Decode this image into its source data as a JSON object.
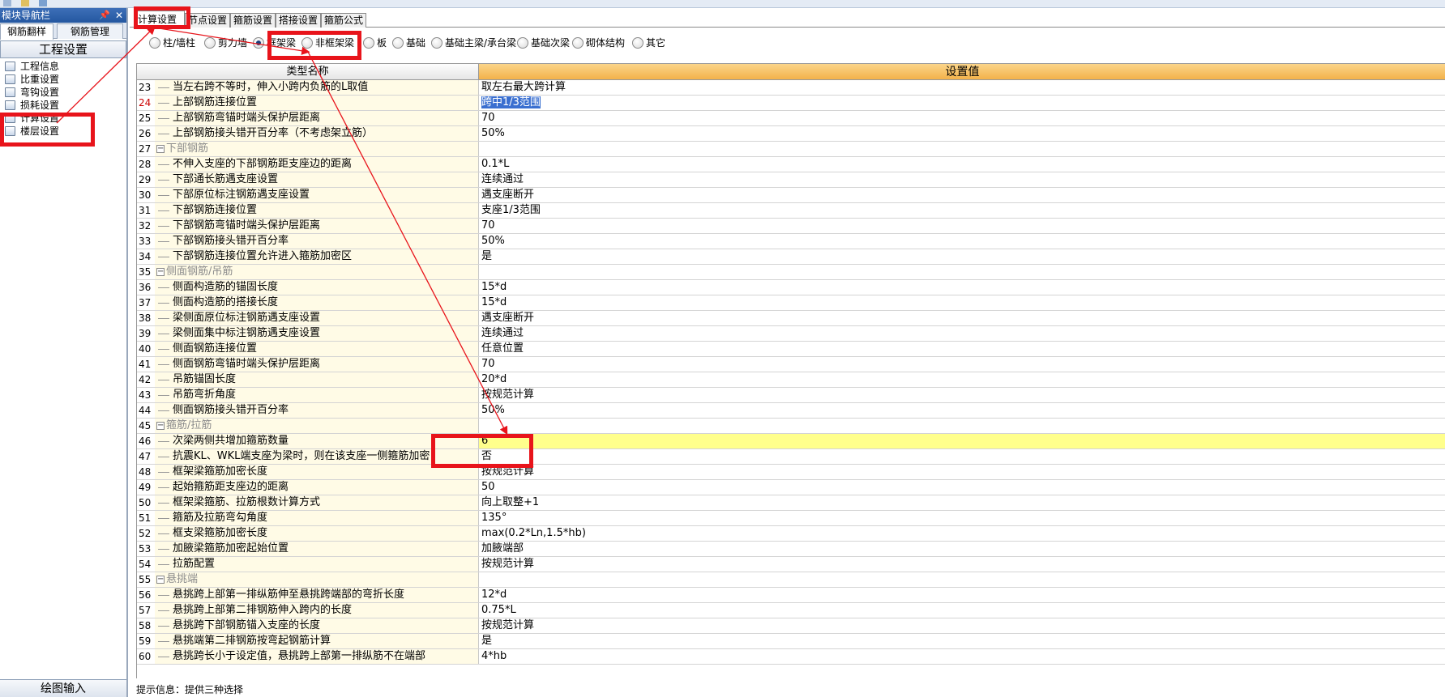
{
  "left_panel": {
    "title": "模块导航栏",
    "pin_icon": "pin-icon",
    "close_icon": "close-icon",
    "tabs": [
      {
        "label": "钢筋翻样"
      },
      {
        "label": "钢筋管理"
      }
    ],
    "group_title": "工程设置",
    "items": [
      {
        "label": "工程信息",
        "icon": "info-icon"
      },
      {
        "label": "比重设置",
        "icon": "weight-icon"
      },
      {
        "label": "弯钩设置",
        "icon": "hook-icon"
      },
      {
        "label": "损耗设置",
        "icon": "loss-icon"
      },
      {
        "label": "计算设置",
        "icon": "calc-settings-icon"
      },
      {
        "label": "楼层设置",
        "icon": "floor-settings-icon"
      }
    ],
    "bottom_button": "绘图输入"
  },
  "tabs": [
    {
      "label": "计算设置",
      "active": true
    },
    {
      "label": "节点设置"
    },
    {
      "label": "箍筋设置"
    },
    {
      "label": "搭接设置"
    },
    {
      "label": "箍筋公式"
    }
  ],
  "radios": [
    {
      "label": "柱/墙柱"
    },
    {
      "label": "剪力墙"
    },
    {
      "label": "框架梁",
      "checked": true
    },
    {
      "label": "非框架梁"
    },
    {
      "label": "板"
    },
    {
      "label": "基础"
    },
    {
      "label": "基础主梁/承台梁"
    },
    {
      "label": "基础次梁"
    },
    {
      "label": "砌体结构"
    },
    {
      "label": "其它"
    }
  ],
  "grid": {
    "col_name": "类型名称",
    "col_value": "设置值",
    "rows": [
      {
        "num": "23",
        "name": "当左右跨不等时，伸入小跨内负筋的L取值",
        "value": "取左右最大跨计算"
      },
      {
        "num": "24",
        "name": "上部钢筋连接位置",
        "value": "跨中1/3范围",
        "selected": true
      },
      {
        "num": "25",
        "name": "上部钢筋弯锚时端头保护层距离",
        "value": "70"
      },
      {
        "num": "26",
        "name": "上部钢筋接头错开百分率（不考虑架立筋）",
        "value": "50%"
      },
      {
        "num": "27",
        "name": "下部钢筋",
        "value": "",
        "group": true
      },
      {
        "num": "28",
        "name": "不伸入支座的下部钢筋距支座边的距离",
        "value": "0.1*L"
      },
      {
        "num": "29",
        "name": "下部通长筋遇支座设置",
        "value": "连续通过"
      },
      {
        "num": "30",
        "name": "下部原位标注钢筋遇支座设置",
        "value": "遇支座断开"
      },
      {
        "num": "31",
        "name": "下部钢筋连接位置",
        "value": "支座1/3范围"
      },
      {
        "num": "32",
        "name": "下部钢筋弯锚时端头保护层距离",
        "value": "70"
      },
      {
        "num": "33",
        "name": "下部钢筋接头错开百分率",
        "value": "50%"
      },
      {
        "num": "34",
        "name": "下部钢筋连接位置允许进入箍筋加密区",
        "value": "是"
      },
      {
        "num": "35",
        "name": "侧面钢筋/吊筋",
        "value": "",
        "group": true
      },
      {
        "num": "36",
        "name": "侧面构造筋的锚固长度",
        "value": "15*d"
      },
      {
        "num": "37",
        "name": "侧面构造筋的搭接长度",
        "value": "15*d"
      },
      {
        "num": "38",
        "name": "梁侧面原位标注钢筋遇支座设置",
        "value": "遇支座断开"
      },
      {
        "num": "39",
        "name": "梁侧面集中标注钢筋遇支座设置",
        "value": "连续通过"
      },
      {
        "num": "40",
        "name": "侧面钢筋连接位置",
        "value": "任意位置"
      },
      {
        "num": "41",
        "name": "侧面钢筋弯锚时端头保护层距离",
        "value": "70"
      },
      {
        "num": "42",
        "name": "吊筋锚固长度",
        "value": "20*d"
      },
      {
        "num": "43",
        "name": "吊筋弯折角度",
        "value": "按规范计算"
      },
      {
        "num": "44",
        "name": "侧面钢筋接头错开百分率",
        "value": "50%"
      },
      {
        "num": "45",
        "name": "箍筋/拉筋",
        "value": "",
        "group": true
      },
      {
        "num": "46",
        "name": "次梁两侧共增加箍筋数量",
        "value": "6",
        "highlight": true
      },
      {
        "num": "47",
        "name": "抗震KL、WKL端支座为梁时，则在该支座一侧箍筋加密",
        "value": "否"
      },
      {
        "num": "48",
        "name": "框架梁箍筋加密长度",
        "value": "按规范计算"
      },
      {
        "num": "49",
        "name": "起始箍筋距支座边的距离",
        "value": "50"
      },
      {
        "num": "50",
        "name": "框架梁箍筋、拉筋根数计算方式",
        "value": "向上取整+1"
      },
      {
        "num": "51",
        "name": "箍筋及拉筋弯勾角度",
        "value": "135°"
      },
      {
        "num": "52",
        "name": "框支梁箍筋加密长度",
        "value": "max(0.2*Ln,1.5*hb)"
      },
      {
        "num": "53",
        "name": "加腋梁箍筋加密起始位置",
        "value": "加腋端部"
      },
      {
        "num": "54",
        "name": "拉筋配置",
        "value": "按规范计算"
      },
      {
        "num": "55",
        "name": "悬挑端",
        "value": "",
        "group": true
      },
      {
        "num": "56",
        "name": "悬挑跨上部第一排纵筋伸至悬挑跨端部的弯折长度",
        "value": "12*d"
      },
      {
        "num": "57",
        "name": "悬挑跨上部第二排钢筋伸入跨内的长度",
        "value": "0.75*L"
      },
      {
        "num": "58",
        "name": "悬挑跨下部钢筋锚入支座的长度",
        "value": "按规范计算"
      },
      {
        "num": "59",
        "name": "悬挑端第二排钢筋按弯起钢筋计算",
        "value": "是"
      },
      {
        "num": "60",
        "name": "悬挑跨长小于设定值，悬挑跨上部第一排纵筋不在端部",
        "value": "4*hb"
      }
    ]
  },
  "status_text": "提示信息：提供三种选择",
  "colors": {
    "annotation": "#e8141b",
    "header_value_bg": "#f3b24a",
    "highlight_row": "#ffff8c",
    "selection": "#3a6fd0"
  }
}
